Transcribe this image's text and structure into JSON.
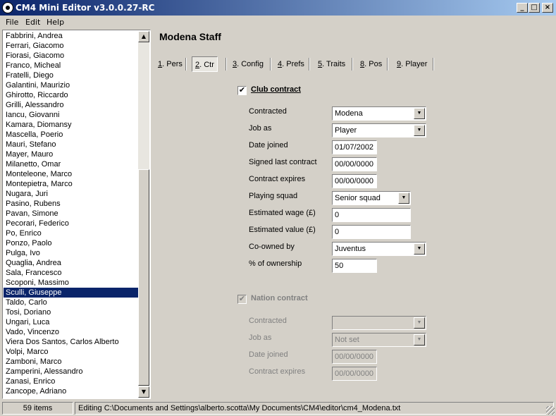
{
  "window": {
    "title": "CM4 Mini Editor v3.0.0.27-RC"
  },
  "menu": [
    "File",
    "Edit",
    "Help"
  ],
  "list": {
    "items": [
      "Fabbrini, Andrea",
      "Ferrari, Giacomo",
      "Fiorasi, Giacomo",
      "Franco, Micheal",
      "Fratelli, Diego",
      "Galantini, Maurizio",
      "Ghirotto, Riccardo",
      "Grilli, Alessandro",
      "Iancu, Giovanni",
      "Kamara, Diomansy",
      "Mascella, Poerio",
      "Mauri, Stefano",
      "Mayer, Mauro",
      "Milanetto, Omar",
      "Monteleone, Marco",
      "Montepietra, Marco",
      "Nugara, Juri",
      "Pasino, Rubens",
      "Pavan, Simone",
      "Pecorari, Federico",
      "Po, Enrico",
      "Ponzo, Paolo",
      "Pulga, Ivo",
      "Quaglia, Andrea",
      "Sala, Francesco",
      "Scoponi, Massimo",
      "Sculli, Giuseppe",
      "Taldo, Carlo",
      "Tosi, Doriano",
      "Ungari, Luca",
      "Vado, Vincenzo",
      "Viera Dos Santos, Carlos Alberto",
      "Volpi, Marco",
      "Zamboni, Marco",
      "Zamperini, Alessandro",
      "Zanasi, Enrico",
      "Zancope, Adriano"
    ],
    "selected_index": 26
  },
  "page_title": "Modena Staff",
  "tabs": [
    {
      "key": "1",
      "label": ". Pers"
    },
    {
      "key": "2",
      "label": ". Ctr"
    },
    {
      "key": "3",
      "label": ". Config"
    },
    {
      "key": "4",
      "label": ". Prefs"
    },
    {
      "key": "5",
      "label": ". Traits"
    },
    {
      "key": "8",
      "label": ". Pos"
    },
    {
      "key": "9",
      "label": ". Player"
    }
  ],
  "club": {
    "label": "Club contract",
    "checked": "✔",
    "fields": {
      "contracted": {
        "label": "Contracted",
        "value": "Modena"
      },
      "job": {
        "label": "Job as",
        "value": "Player"
      },
      "date_joined": {
        "label": "Date joined",
        "value": "01/07/2002"
      },
      "signed_last": {
        "label": "Signed last contract",
        "value": "00/00/0000"
      },
      "expires": {
        "label": "Contract expires",
        "value": "00/00/0000"
      },
      "squad": {
        "label": "Playing squad",
        "value": "Senior squad"
      },
      "wage": {
        "label": "Estimated wage (£)",
        "value": "0"
      },
      "value": {
        "label": "Estimated value (£)",
        "value": "0"
      },
      "coowned": {
        "label": "Co-owned by",
        "value": "Juventus"
      },
      "ownership": {
        "label": "% of ownership",
        "value": "50"
      }
    }
  },
  "nation": {
    "label": "Nation contract",
    "checked": "✔",
    "fields": {
      "contracted": {
        "label": "Contracted",
        "value": ""
      },
      "job": {
        "label": "Job as",
        "value": "Not set"
      },
      "date_joined": {
        "label": "Date joined",
        "value": "00/00/0000"
      },
      "expires": {
        "label": "Contract expires",
        "value": "00/00/0000"
      }
    }
  },
  "status": {
    "count": "59 items",
    "editing": "Editing C:\\Documents and Settings\\alberto.scotta\\My Documents\\CM4\\editor\\cm4_Modena.txt"
  }
}
